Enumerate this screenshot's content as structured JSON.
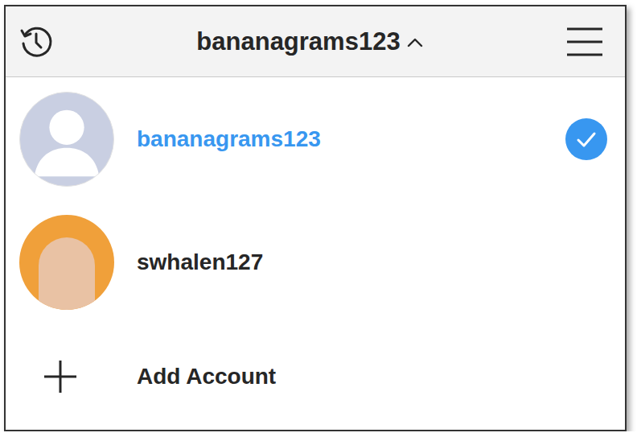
{
  "header": {
    "title": "bananagrams123",
    "expanded": true
  },
  "accounts": [
    {
      "username": "bananagrams123",
      "selected": true,
      "kind": "default"
    },
    {
      "username": "swhalen127",
      "selected": false,
      "kind": "photo"
    }
  ],
  "add_account": {
    "label": "Add Account"
  }
}
